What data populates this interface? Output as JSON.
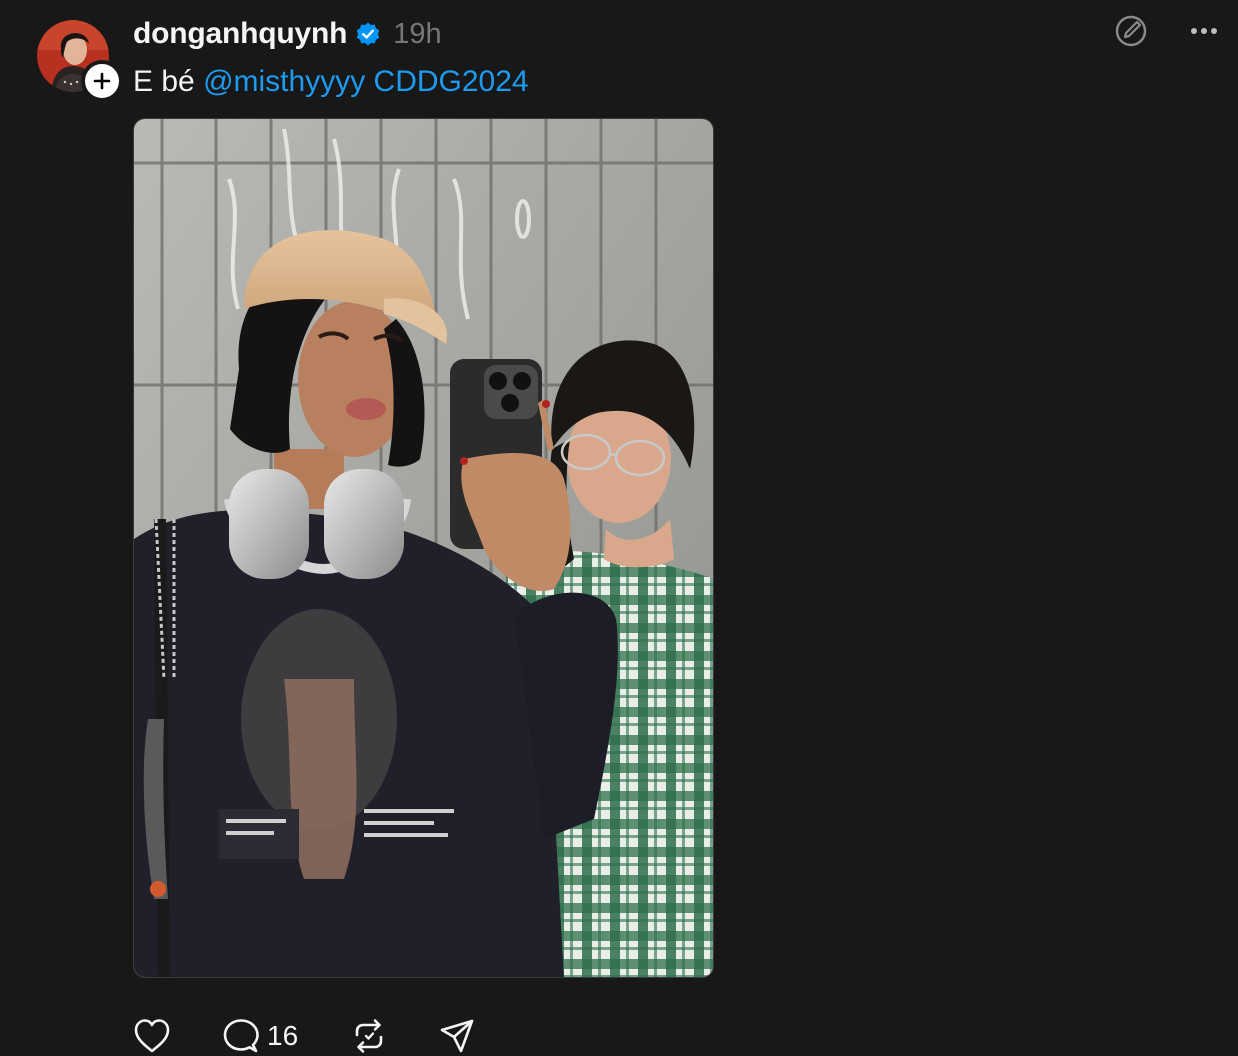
{
  "post": {
    "username": "donganhquynh",
    "time": "19h",
    "caption_text": "E bé ",
    "caption_mention": "@misthyyyy",
    "caption_space": " ",
    "caption_hashtag": "CDDG2024",
    "comment_count": "16",
    "verified": true
  },
  "icons": {
    "follow": "plus-icon",
    "verified": "verified-badge-icon",
    "edit": "edit-circle-icon",
    "more": "more-dots-icon",
    "like": "heart-icon",
    "comment": "comment-bubble-icon",
    "repost": "repost-icon",
    "share": "send-icon"
  },
  "colors": {
    "background": "#181818",
    "text": "#f3f5f7",
    "muted": "#777777",
    "link": "#1d9bf0",
    "verified": "#0095f6"
  }
}
